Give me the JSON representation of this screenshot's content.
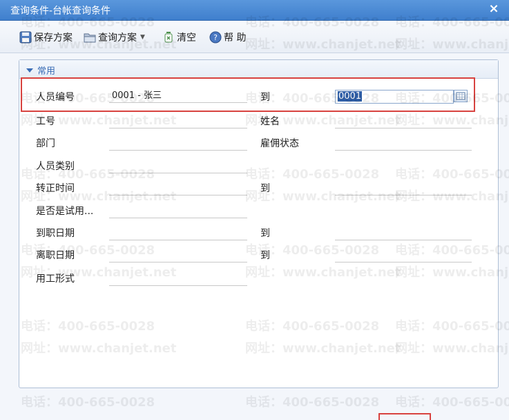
{
  "window": {
    "title": "查询条件-台帐查询条件",
    "close_glyph": "×"
  },
  "toolbar": {
    "save_scheme": "保存方案",
    "query_scheme": "查询方案",
    "clear": "清空",
    "help": "帮 助"
  },
  "section": {
    "label": "常用"
  },
  "fields": {
    "employee_no": {
      "label": "人员编号",
      "from_value": "0001 - 张三",
      "to_label": "到",
      "to_value": "0001"
    },
    "work_no": {
      "label": "工号"
    },
    "name": {
      "label": "姓名"
    },
    "department": {
      "label": "部门"
    },
    "employment_status": {
      "label": "雇佣状态"
    },
    "staff_category": {
      "label": "人员类别"
    },
    "regularization_time": {
      "label": "转正时间",
      "to_label": "到"
    },
    "on_probation": {
      "label": "是否是试用..."
    },
    "hire_date": {
      "label": "到职日期",
      "to_label": "到"
    },
    "leave_date": {
      "label": "离职日期",
      "to_label": "到"
    },
    "employment_form": {
      "label": "用工形式"
    }
  },
  "watermark": {
    "phone": "电话：400-665-0028",
    "site": "网址：www.chanjet.net"
  },
  "icons": {
    "save": "save-icon",
    "folder": "folder-icon",
    "clear": "clear-icon",
    "help": "help-icon",
    "calendar": "calendar-icon"
  }
}
